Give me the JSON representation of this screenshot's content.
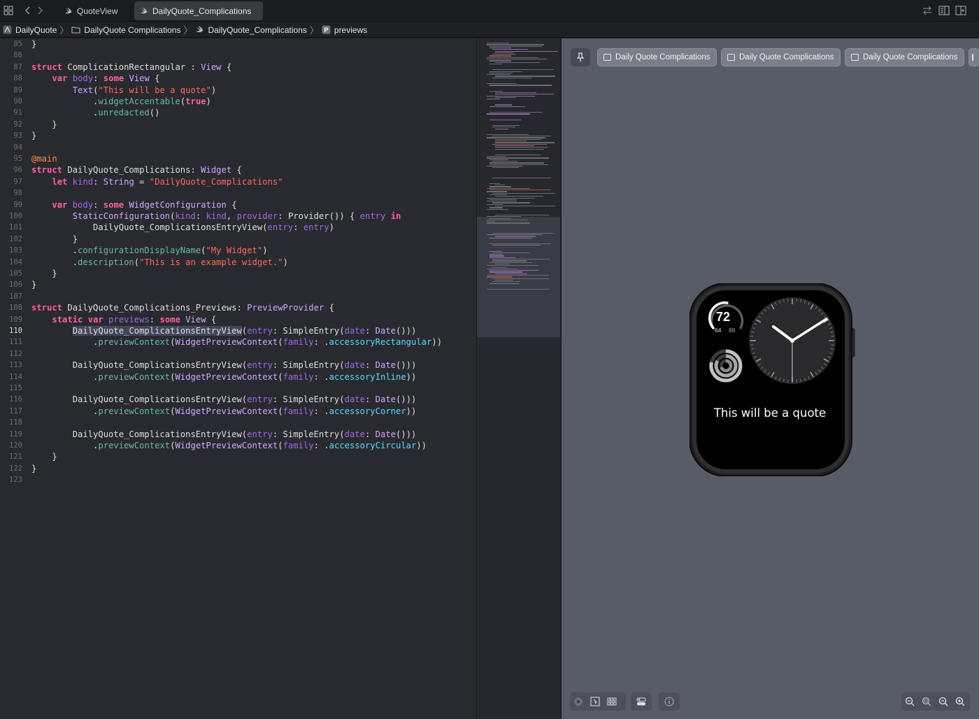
{
  "tabs": [
    {
      "label": "QuoteView",
      "active": false
    },
    {
      "label": "DailyQuote_Complications",
      "active": true
    }
  ],
  "breadcrumbs": [
    "DailyQuote",
    "DailyQuote Complications",
    "DailyQuote_Complications",
    "previews"
  ],
  "editor": {
    "current_line": 110,
    "lines": [
      {
        "n": "85",
        "code": "}"
      },
      {
        "n": "86",
        "code": ""
      },
      {
        "n": "87",
        "code": "struct ComplicationRectangular : View {"
      },
      {
        "n": "88",
        "code": "    var body: some View {"
      },
      {
        "n": "89",
        "code": "        Text(\"This will be a quote\")"
      },
      {
        "n": "90",
        "code": "            .widgetAccentable(true)"
      },
      {
        "n": "91",
        "code": "            .unredacted()"
      },
      {
        "n": "92",
        "code": "    }"
      },
      {
        "n": "93",
        "code": "}"
      },
      {
        "n": "94",
        "code": ""
      },
      {
        "n": "95",
        "code": "@main"
      },
      {
        "n": "96",
        "code": "struct DailyQuote_Complications: Widget {"
      },
      {
        "n": "97",
        "code": "    let kind: String = \"DailyQuote_Complications\""
      },
      {
        "n": "98",
        "code": ""
      },
      {
        "n": "99",
        "code": "    var body: some WidgetConfiguration {"
      },
      {
        "n": "100",
        "code": "        StaticConfiguration(kind: kind, provider: Provider()) { entry in"
      },
      {
        "n": "101",
        "code": "            DailyQuote_ComplicationsEntryView(entry: entry)"
      },
      {
        "n": "102",
        "code": "        }"
      },
      {
        "n": "103",
        "code": "        .configurationDisplayName(\"My Widget\")"
      },
      {
        "n": "104",
        "code": "        .description(\"This is an example widget.\")"
      },
      {
        "n": "105",
        "code": "    }"
      },
      {
        "n": "106",
        "code": "}"
      },
      {
        "n": "107",
        "code": ""
      },
      {
        "n": "108",
        "code": "struct DailyQuote_Complications_Previews: PreviewProvider {"
      },
      {
        "n": "109",
        "code": "    static var previews: some View {"
      },
      {
        "n": "110",
        "code": "        DailyQuote_ComplicationsEntryView(entry: SimpleEntry(date: Date()))"
      },
      {
        "n": "111",
        "code": "            .previewContext(WidgetPreviewContext(family: .accessoryRectangular))"
      },
      {
        "n": "112",
        "code": ""
      },
      {
        "n": "113",
        "code": "        DailyQuote_ComplicationsEntryView(entry: SimpleEntry(date: Date()))"
      },
      {
        "n": "114",
        "code": "            .previewContext(WidgetPreviewContext(family: .accessoryInline))"
      },
      {
        "n": "115",
        "code": ""
      },
      {
        "n": "116",
        "code": "        DailyQuote_ComplicationsEntryView(entry: SimpleEntry(date: Date()))"
      },
      {
        "n": "117",
        "code": "            .previewContext(WidgetPreviewContext(family: .accessoryCorner))"
      },
      {
        "n": "118",
        "code": ""
      },
      {
        "n": "119",
        "code": "        DailyQuote_ComplicationsEntryView(entry: SimpleEntry(date: Date()))"
      },
      {
        "n": "120",
        "code": "            .previewContext(WidgetPreviewContext(family: .accessoryCircular))"
      },
      {
        "n": "121",
        "code": "    }"
      },
      {
        "n": "122",
        "code": "}"
      },
      {
        "n": "123",
        "code": ""
      }
    ]
  },
  "preview": {
    "variant_buttons": [
      "Daily Quote Complications",
      "Daily Quote Complications",
      "Daily Quote Complications"
    ],
    "watch": {
      "temperature": "72",
      "temp_low": "64",
      "temp_high": "88",
      "quote_text": "This will be a quote"
    }
  },
  "icons": {
    "tabbar": [
      "grid-icon",
      "back-chevron-icon",
      "forward-chevron-icon",
      "swift-file-icon",
      "swap-icon",
      "inspector-icon",
      "add-editor-icon"
    ],
    "preview_bottom": [
      "live-preview-icon",
      "selectable-icon",
      "variants-icon",
      "device-settings-icon",
      "info-icon",
      "zoom-out-icon",
      "zoom-fit-icon",
      "zoom-100-icon",
      "zoom-in-icon"
    ]
  }
}
